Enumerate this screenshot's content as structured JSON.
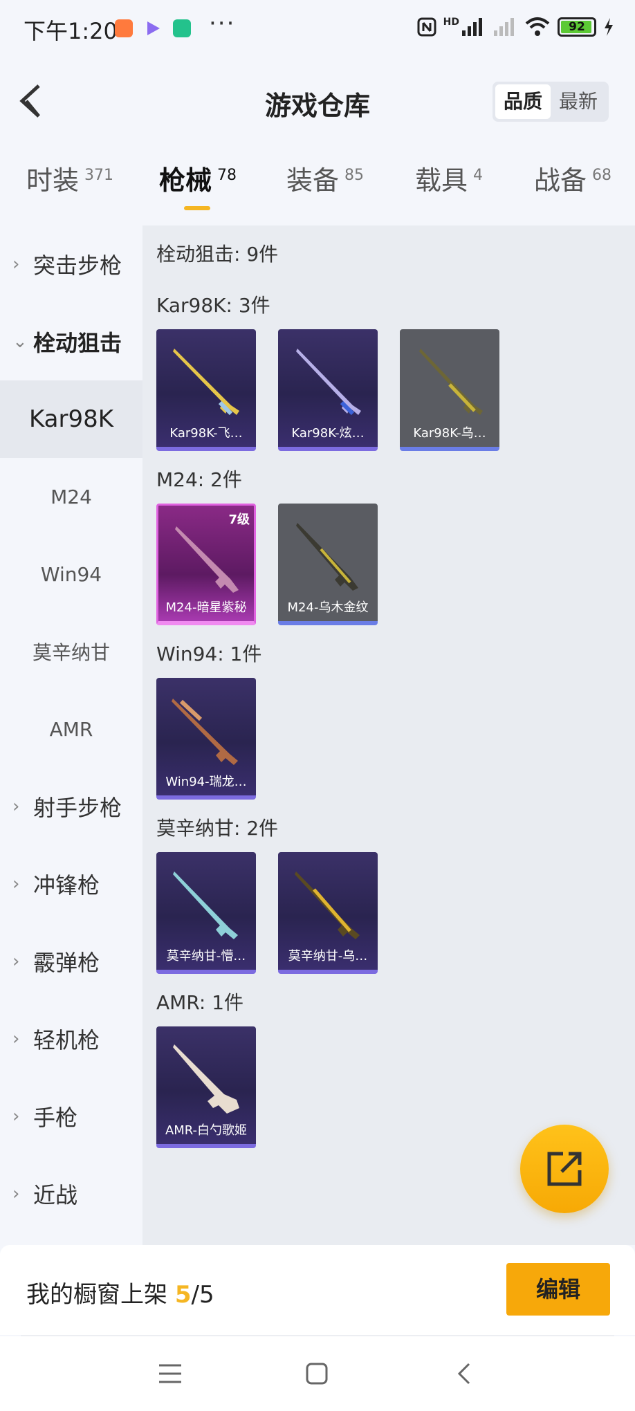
{
  "status_bar": {
    "time": "下午1:20",
    "more": "···",
    "battery": "92",
    "network": "HD"
  },
  "header": {
    "title": "游戏仓库",
    "sort_quality": "品质",
    "sort_latest": "最新"
  },
  "tabs": [
    {
      "label": "时装",
      "count": "371"
    },
    {
      "label": "枪械",
      "count": "78"
    },
    {
      "label": "装备",
      "count": "85"
    },
    {
      "label": "载具",
      "count": "4"
    },
    {
      "label": "战备",
      "count": "68"
    }
  ],
  "sidebar": {
    "items": [
      {
        "label": "突击步枪"
      },
      {
        "label": "栓动狙击"
      },
      {
        "label": "Kar98K"
      },
      {
        "label": "M24"
      },
      {
        "label": "Win94"
      },
      {
        "label": "莫辛纳甘"
      },
      {
        "label": "AMR"
      },
      {
        "label": "射手步枪"
      },
      {
        "label": "冲锋枪"
      },
      {
        "label": "霰弹枪"
      },
      {
        "label": "轻机枪"
      },
      {
        "label": "手枪"
      },
      {
        "label": "近战"
      }
    ]
  },
  "main": {
    "summary": "栓动狙击: 9件",
    "groups": [
      {
        "title": "Kar98K: 3件",
        "items": [
          {
            "name": "Kar98K-飞…"
          },
          {
            "name": "Kar98K-炫…"
          },
          {
            "name": "Kar98K-乌…"
          }
        ]
      },
      {
        "title": "M24: 2件",
        "items": [
          {
            "name": "M24-暗星紫秘",
            "level": "7级"
          },
          {
            "name": "M24-乌木金纹"
          }
        ]
      },
      {
        "title": "Win94: 1件",
        "items": [
          {
            "name": "Win94-瑞龙…"
          }
        ]
      },
      {
        "title": "莫辛纳甘: 2件",
        "items": [
          {
            "name": "莫辛纳甘-懵…"
          },
          {
            "name": "莫辛纳甘-乌…"
          }
        ]
      },
      {
        "title": "AMR: 1件",
        "items": [
          {
            "name": "AMR-白勺歌姬"
          }
        ]
      }
    ]
  },
  "bottom": {
    "label": "我的橱窗上架 ",
    "current": "5",
    "total": "/5",
    "edit": "编辑"
  },
  "colors": {
    "accent": "#f5b623",
    "button": "#f7a80a",
    "card_purple": "#2a2450",
    "card_grey": "#5a5c62",
    "card_pink": "#8a2a86"
  },
  "icons": [
    "back-icon",
    "share-icon",
    "chevron-right-icon",
    "chevron-down-icon",
    "menu-icon",
    "home-icon",
    "nav-back-icon"
  ]
}
